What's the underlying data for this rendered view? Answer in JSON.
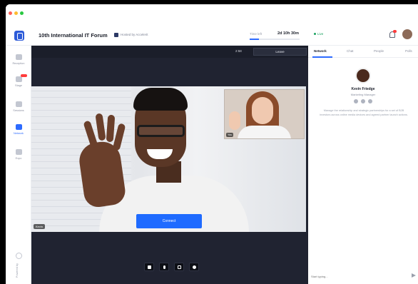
{
  "window": {
    "controls": [
      "close",
      "minimize",
      "zoom"
    ]
  },
  "header": {
    "event_title": "10th International IT Forum",
    "hosted_by": "Hosted by Accelerit",
    "time_left_label": "Time left",
    "time_left_value": "2d 10h 30m",
    "time_progress_percent": 18,
    "status_text": "Live",
    "notification_badge": "9"
  },
  "sidebar": {
    "items": [
      {
        "label": "Reception",
        "icon": "home-icon"
      },
      {
        "label": "Stage",
        "icon": "stage-icon"
      },
      {
        "label": "Sessions",
        "icon": "sessions-icon"
      },
      {
        "label": "Network",
        "icon": "network-icon"
      },
      {
        "label": "Expo",
        "icon": "expo-icon"
      }
    ],
    "powered_by": "Powered by"
  },
  "stage": {
    "timer": "2:58",
    "leave_label": "Leave",
    "speaker_name": "Kevin",
    "pip_name": "You",
    "connect_label": "Connect",
    "controls": [
      "camera-icon",
      "microphone-icon",
      "screen-share-icon",
      "settings-icon"
    ]
  },
  "right_panel": {
    "tabs": [
      "Network",
      "Chat",
      "People",
      "Polls"
    ],
    "active_tab": "Network",
    "profile": {
      "name": "Kevin Friedge",
      "role": "Marketing Manager",
      "bio": "Manage the relationship and strategic partnerships for a set of B2B investors across online media devices and agreed partner launch actions."
    },
    "message_placeholder": "Start typing..."
  },
  "colors": {
    "accent": "#1f6bff",
    "live": "#1aa260",
    "stage_bg": "#202331",
    "badge": "#ff3b3b"
  }
}
